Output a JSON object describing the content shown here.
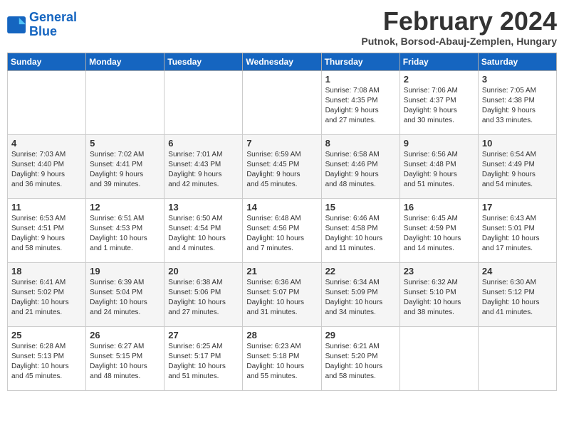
{
  "header": {
    "logo_line1": "General",
    "logo_line2": "Blue",
    "month_title": "February 2024",
    "location": "Putnok, Borsod-Abauj-Zemplen, Hungary"
  },
  "days_of_week": [
    "Sunday",
    "Monday",
    "Tuesday",
    "Wednesday",
    "Thursday",
    "Friday",
    "Saturday"
  ],
  "weeks": [
    [
      {
        "day": "",
        "info": ""
      },
      {
        "day": "",
        "info": ""
      },
      {
        "day": "",
        "info": ""
      },
      {
        "day": "",
        "info": ""
      },
      {
        "day": "1",
        "info": "Sunrise: 7:08 AM\nSunset: 4:35 PM\nDaylight: 9 hours\nand 27 minutes."
      },
      {
        "day": "2",
        "info": "Sunrise: 7:06 AM\nSunset: 4:37 PM\nDaylight: 9 hours\nand 30 minutes."
      },
      {
        "day": "3",
        "info": "Sunrise: 7:05 AM\nSunset: 4:38 PM\nDaylight: 9 hours\nand 33 minutes."
      }
    ],
    [
      {
        "day": "4",
        "info": "Sunrise: 7:03 AM\nSunset: 4:40 PM\nDaylight: 9 hours\nand 36 minutes."
      },
      {
        "day": "5",
        "info": "Sunrise: 7:02 AM\nSunset: 4:41 PM\nDaylight: 9 hours\nand 39 minutes."
      },
      {
        "day": "6",
        "info": "Sunrise: 7:01 AM\nSunset: 4:43 PM\nDaylight: 9 hours\nand 42 minutes."
      },
      {
        "day": "7",
        "info": "Sunrise: 6:59 AM\nSunset: 4:45 PM\nDaylight: 9 hours\nand 45 minutes."
      },
      {
        "day": "8",
        "info": "Sunrise: 6:58 AM\nSunset: 4:46 PM\nDaylight: 9 hours\nand 48 minutes."
      },
      {
        "day": "9",
        "info": "Sunrise: 6:56 AM\nSunset: 4:48 PM\nDaylight: 9 hours\nand 51 minutes."
      },
      {
        "day": "10",
        "info": "Sunrise: 6:54 AM\nSunset: 4:49 PM\nDaylight: 9 hours\nand 54 minutes."
      }
    ],
    [
      {
        "day": "11",
        "info": "Sunrise: 6:53 AM\nSunset: 4:51 PM\nDaylight: 9 hours\nand 58 minutes."
      },
      {
        "day": "12",
        "info": "Sunrise: 6:51 AM\nSunset: 4:53 PM\nDaylight: 10 hours\nand 1 minute."
      },
      {
        "day": "13",
        "info": "Sunrise: 6:50 AM\nSunset: 4:54 PM\nDaylight: 10 hours\nand 4 minutes."
      },
      {
        "day": "14",
        "info": "Sunrise: 6:48 AM\nSunset: 4:56 PM\nDaylight: 10 hours\nand 7 minutes."
      },
      {
        "day": "15",
        "info": "Sunrise: 6:46 AM\nSunset: 4:58 PM\nDaylight: 10 hours\nand 11 minutes."
      },
      {
        "day": "16",
        "info": "Sunrise: 6:45 AM\nSunset: 4:59 PM\nDaylight: 10 hours\nand 14 minutes."
      },
      {
        "day": "17",
        "info": "Sunrise: 6:43 AM\nSunset: 5:01 PM\nDaylight: 10 hours\nand 17 minutes."
      }
    ],
    [
      {
        "day": "18",
        "info": "Sunrise: 6:41 AM\nSunset: 5:02 PM\nDaylight: 10 hours\nand 21 minutes."
      },
      {
        "day": "19",
        "info": "Sunrise: 6:39 AM\nSunset: 5:04 PM\nDaylight: 10 hours\nand 24 minutes."
      },
      {
        "day": "20",
        "info": "Sunrise: 6:38 AM\nSunset: 5:06 PM\nDaylight: 10 hours\nand 27 minutes."
      },
      {
        "day": "21",
        "info": "Sunrise: 6:36 AM\nSunset: 5:07 PM\nDaylight: 10 hours\nand 31 minutes."
      },
      {
        "day": "22",
        "info": "Sunrise: 6:34 AM\nSunset: 5:09 PM\nDaylight: 10 hours\nand 34 minutes."
      },
      {
        "day": "23",
        "info": "Sunrise: 6:32 AM\nSunset: 5:10 PM\nDaylight: 10 hours\nand 38 minutes."
      },
      {
        "day": "24",
        "info": "Sunrise: 6:30 AM\nSunset: 5:12 PM\nDaylight: 10 hours\nand 41 minutes."
      }
    ],
    [
      {
        "day": "25",
        "info": "Sunrise: 6:28 AM\nSunset: 5:13 PM\nDaylight: 10 hours\nand 45 minutes."
      },
      {
        "day": "26",
        "info": "Sunrise: 6:27 AM\nSunset: 5:15 PM\nDaylight: 10 hours\nand 48 minutes."
      },
      {
        "day": "27",
        "info": "Sunrise: 6:25 AM\nSunset: 5:17 PM\nDaylight: 10 hours\nand 51 minutes."
      },
      {
        "day": "28",
        "info": "Sunrise: 6:23 AM\nSunset: 5:18 PM\nDaylight: 10 hours\nand 55 minutes."
      },
      {
        "day": "29",
        "info": "Sunrise: 6:21 AM\nSunset: 5:20 PM\nDaylight: 10 hours\nand 58 minutes."
      },
      {
        "day": "",
        "info": ""
      },
      {
        "day": "",
        "info": ""
      }
    ]
  ]
}
